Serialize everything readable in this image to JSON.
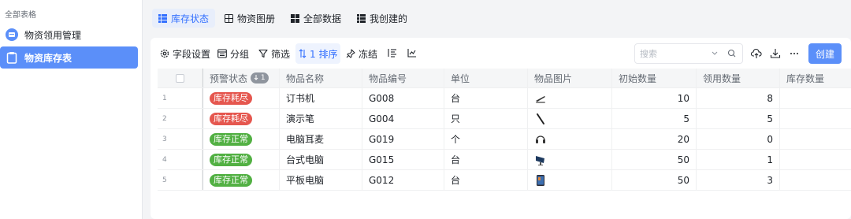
{
  "sidebar": {
    "section_title": "全部表格",
    "items": [
      {
        "label": "物资领用管理",
        "active": false
      },
      {
        "label": "物资库存表",
        "active": true
      }
    ]
  },
  "tabs": [
    {
      "label": "库存状态",
      "active": true
    },
    {
      "label": "物资图册",
      "active": false
    },
    {
      "label": "全部数据",
      "active": false
    },
    {
      "label": "我创建的",
      "active": false
    }
  ],
  "toolbar": {
    "field_settings": "字段设置",
    "group": "分组",
    "filter": "筛选",
    "sort": "1 排序",
    "freeze": "冻结",
    "search_placeholder": "搜索",
    "create": "创建"
  },
  "table": {
    "columns": [
      "预警状态",
      "物品名称",
      "物品编号",
      "单位",
      "物品图片",
      "初始数量",
      "领用数量",
      "库存数量"
    ],
    "status_sort_badge": "1",
    "rows": [
      {
        "index": "1",
        "status": "库存耗尽",
        "status_color": "#e5574f",
        "name": "订书机",
        "code": "G008",
        "unit": "台",
        "image": "stapler-icon",
        "initial": "10",
        "used": "8",
        "stock": ""
      },
      {
        "index": "2",
        "status": "库存耗尽",
        "status_color": "#e5574f",
        "name": "演示笔",
        "code": "G004",
        "unit": "只",
        "image": "pen-icon",
        "initial": "5",
        "used": "5",
        "stock": ""
      },
      {
        "index": "3",
        "status": "库存正常",
        "status_color": "#52b043",
        "name": "电脑耳麦",
        "code": "G019",
        "unit": "个",
        "image": "headset-icon",
        "initial": "20",
        "used": "0",
        "stock": ""
      },
      {
        "index": "4",
        "status": "库存正常",
        "status_color": "#52b043",
        "name": "台式电脑",
        "code": "G015",
        "unit": "台",
        "image": "monitor-icon",
        "initial": "50",
        "used": "1",
        "stock": ""
      },
      {
        "index": "5",
        "status": "库存正常",
        "status_color": "#52b043",
        "name": "平板电脑",
        "code": "G012",
        "unit": "台",
        "image": "tablet-icon",
        "initial": "50",
        "used": "3",
        "stock": ""
      }
    ]
  },
  "colors": {
    "accent": "#5b8ff9",
    "tab_active_text": "#3370ff",
    "danger": "#e5574f",
    "success": "#52b043"
  }
}
